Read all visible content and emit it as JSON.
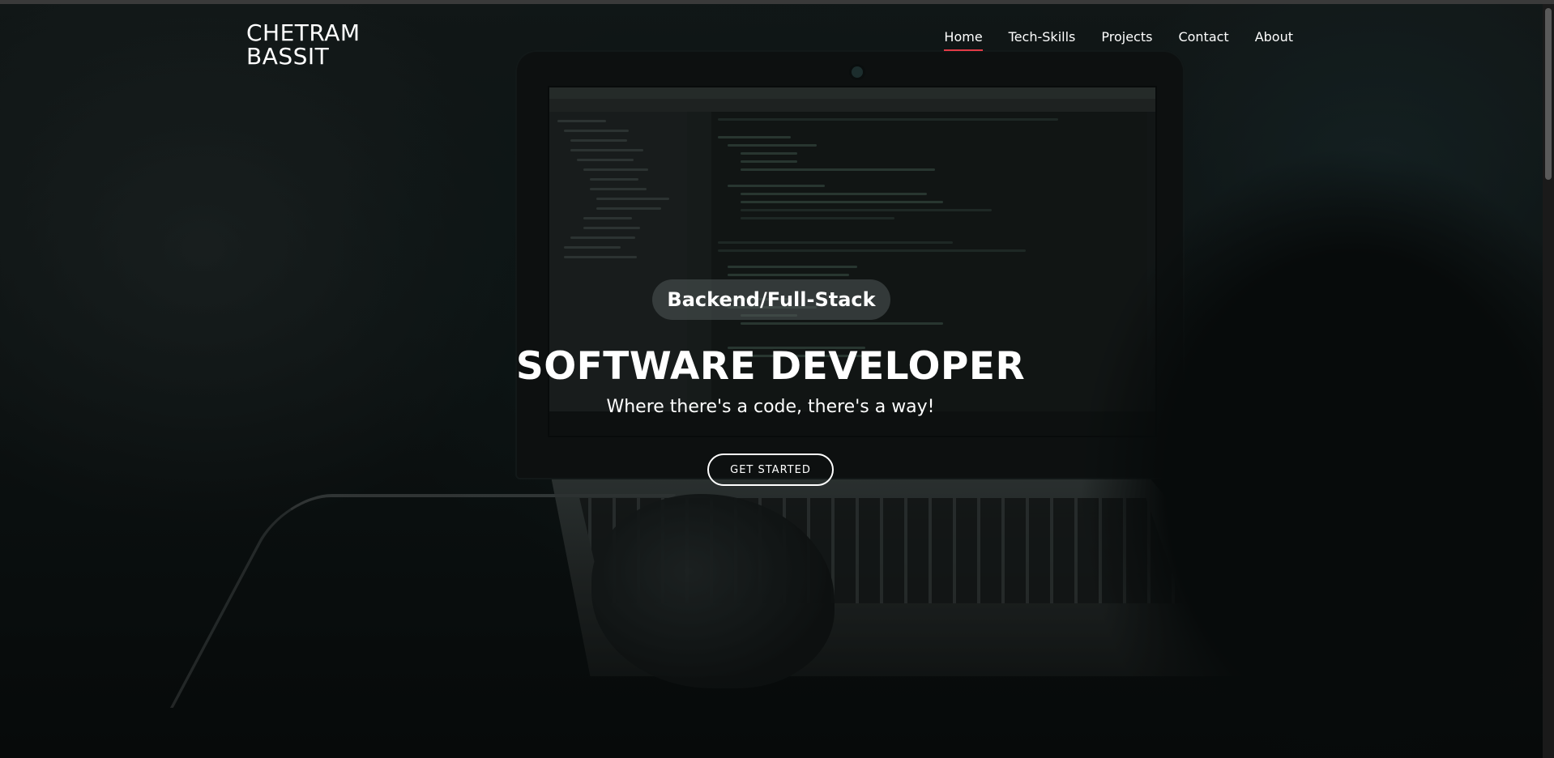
{
  "logo": {
    "line1": "CHETRAM",
    "line2": "BASSIT"
  },
  "nav": {
    "items": [
      {
        "label": "Home",
        "active": true
      },
      {
        "label": "Tech-Skills",
        "active": false
      },
      {
        "label": "Projects",
        "active": false
      },
      {
        "label": "Contact",
        "active": false
      },
      {
        "label": "About",
        "active": false
      }
    ]
  },
  "hero": {
    "badge": "Backend/Full-Stack",
    "title": "SOFTWARE DEVELOPER",
    "tagline": "Where there's a code, there's a way!",
    "cta_label": "GET STARTED"
  },
  "colors": {
    "accent_underline": "#e23b46",
    "text": "#ffffff",
    "badge_bg": "rgba(80,88,88,0.55)"
  }
}
